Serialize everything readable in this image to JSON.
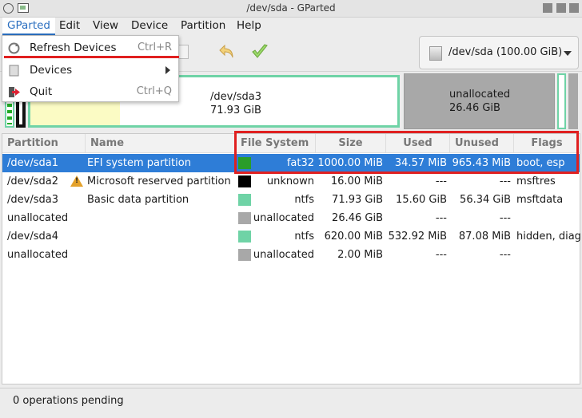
{
  "window": {
    "title": "/dev/sda - GParted"
  },
  "menubar": {
    "items": [
      "GParted",
      "Edit",
      "View",
      "Device",
      "Partition",
      "Help"
    ]
  },
  "gparted_menu": {
    "items": [
      {
        "label": "Refresh Devices",
        "accel": "Ctrl+R",
        "icon": "refresh-icon"
      },
      {
        "label": "Devices",
        "accel": "",
        "icon": "drive-icon",
        "submenu": true
      },
      {
        "label": "Quit",
        "accel": "Ctrl+Q",
        "icon": "quit-icon"
      }
    ]
  },
  "toolbar": {
    "device": "/dev/sda (100.00 GiB)"
  },
  "diskmap": {
    "sda3": {
      "name": "/dev/sda3",
      "size": "71.93 GiB"
    },
    "unallocated": {
      "name": "unallocated",
      "size": "26.46 GiB"
    }
  },
  "table": {
    "columns": [
      "Partition",
      "Name",
      "File System",
      "Size",
      "Used",
      "Unused",
      "Flags"
    ],
    "rows": [
      {
        "partition": "/dev/sda1",
        "name": "EFI system partition",
        "fs": "fat32",
        "fs_color": "#2a9d2a",
        "size": "1000.00 MiB",
        "used": "34.57 MiB",
        "unused": "965.43 MiB",
        "flags": "boot, esp",
        "selected": true,
        "warning": false
      },
      {
        "partition": "/dev/sda2",
        "name": "Microsoft reserved partition",
        "fs": "unknown",
        "fs_color": "#000000",
        "size": "16.00 MiB",
        "used": "---",
        "unused": "---",
        "flags": "msftres",
        "selected": false,
        "warning": true
      },
      {
        "partition": "/dev/sda3",
        "name": "Basic data partition",
        "fs": "ntfs",
        "fs_color": "#6fd3a6",
        "size": "71.93 GiB",
        "used": "15.60 GiB",
        "unused": "56.34 GiB",
        "flags": "msftdata",
        "selected": false,
        "warning": false
      },
      {
        "partition": "unallocated",
        "name": "",
        "fs": "unallocated",
        "fs_color": "#a8a8a8",
        "size": "26.46 GiB",
        "used": "---",
        "unused": "---",
        "flags": "",
        "selected": false,
        "warning": false
      },
      {
        "partition": "/dev/sda4",
        "name": "",
        "fs": "ntfs",
        "fs_color": "#6fd3a6",
        "size": "620.00 MiB",
        "used": "532.92 MiB",
        "unused": "87.08 MiB",
        "flags": "hidden, diag",
        "selected": false,
        "warning": false
      },
      {
        "partition": "unallocated",
        "name": "",
        "fs": "unallocated",
        "fs_color": "#a8a8a8",
        "size": "2.00 MiB",
        "used": "---",
        "unused": "---",
        "flags": "",
        "selected": false,
        "warning": false
      }
    ]
  },
  "statusbar": {
    "text": "0 operations pending"
  },
  "colors": {
    "accent": "#2e7dd7",
    "highlight": "#e02020"
  }
}
